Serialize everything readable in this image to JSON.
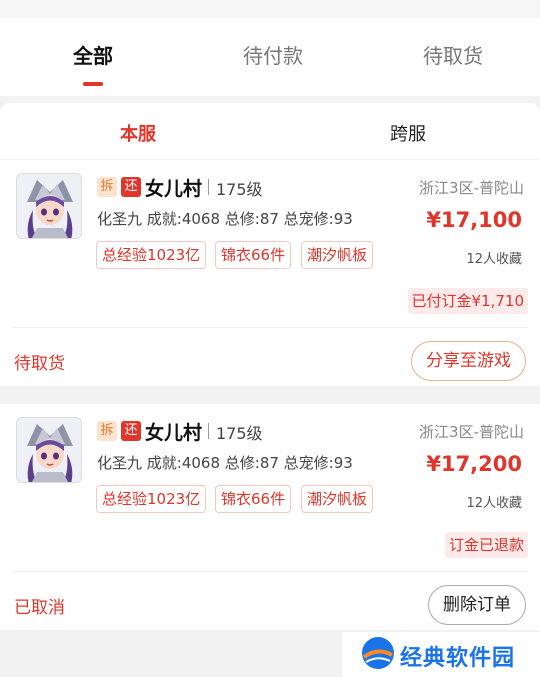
{
  "tabs": [
    {
      "label": "全部",
      "active": true
    },
    {
      "label": "待付款",
      "active": false
    },
    {
      "label": "待取货",
      "active": false
    }
  ],
  "server_switch": {
    "local": "本服",
    "cross": "跨服"
  },
  "orders": [
    {
      "tag_chai": "拆",
      "tag_huan": "还",
      "name": "女儿村",
      "level": "175级",
      "server": "浙江3区-普陀山",
      "stats": "化圣九 成就:4068 总修:87 总宠修:93",
      "price": "¥17,100",
      "favorites": "12人收藏",
      "chips": [
        "总经验1023亿",
        "锦衣66件",
        "潮汐帆板"
      ],
      "deposit": "已付订金¥1,710",
      "status": "待取货",
      "action": "分享至游戏"
    },
    {
      "tag_chai": "拆",
      "tag_huan": "还",
      "name": "女儿村",
      "level": "175级",
      "server": "浙江3区-普陀山",
      "stats": "化圣九 成就:4068 总修:87 总宠修:93",
      "price": "¥17,200",
      "favorites": "12人收藏",
      "chips": [
        "总经验1023亿",
        "锦衣66件",
        "潮汐帆板"
      ],
      "deposit": "订金已退款",
      "status": "已取消",
      "action": "删除订单"
    }
  ],
  "watermark": {
    "text": "经典软件园",
    "icon": "globe-logo-icon"
  },
  "colors": {
    "accent": "#e0352b",
    "watermark_blue": "#1a73e8"
  }
}
